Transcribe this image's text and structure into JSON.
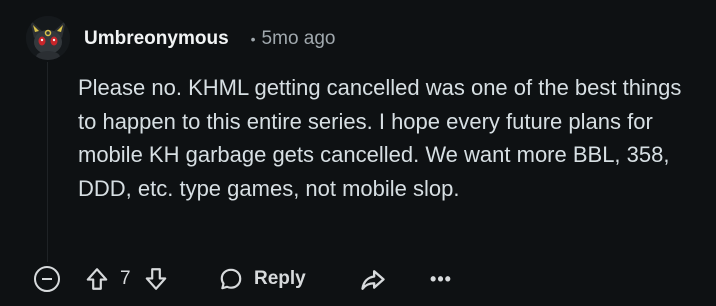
{
  "comment": {
    "author": "Umbreonymous",
    "separator": "•",
    "timestamp": "5mo ago",
    "body": "Please no. KHML getting cancelled was one of the best things to happen to this entire series. I hope every future plans for mobile KH garbage gets cancelled. We want more BBL, 358, DDD, etc. type games, not mobile slop.",
    "score": "7",
    "avatar_icon": "umbreon-avatar-icon"
  },
  "actions": {
    "collapse_icon": "minus-circle-icon",
    "upvote_icon": "upvote-arrow-icon",
    "downvote_icon": "downvote-arrow-icon",
    "reply_icon": "speech-bubble-icon",
    "reply_label": "Reply",
    "share_icon": "share-arrow-icon",
    "more_label": "•••"
  },
  "colors": {
    "background": "#0e1113",
    "text": "#d7dadc",
    "muted": "#a0a8ad"
  }
}
